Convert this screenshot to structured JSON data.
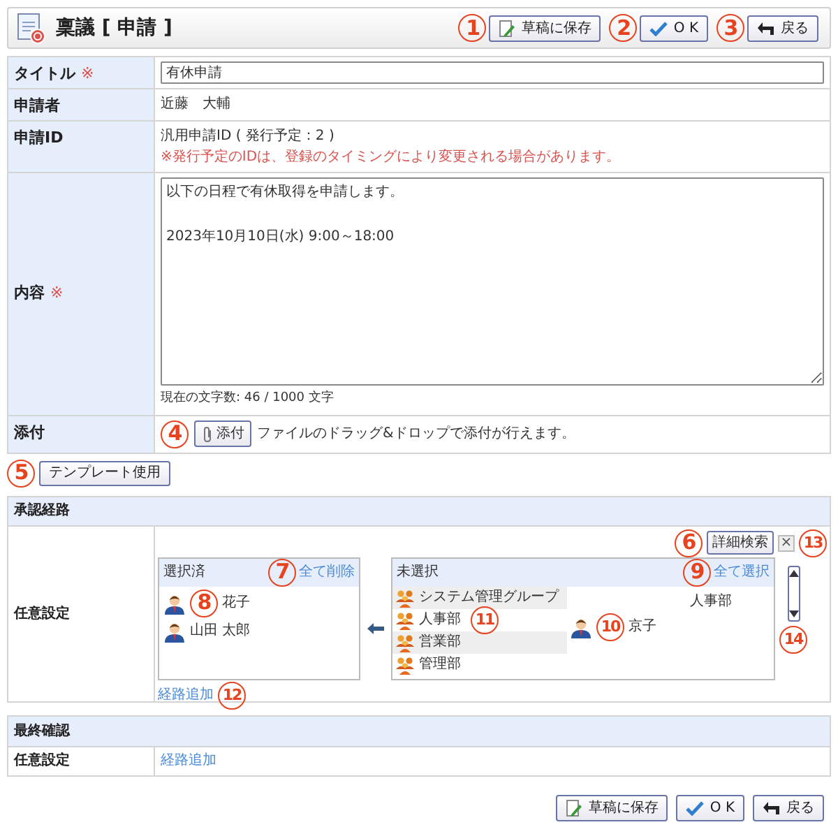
{
  "header": {
    "title": "稟議 [ 申請 ]",
    "buttons": [
      {
        "kind": "save",
        "label": "草稿に保存"
      },
      {
        "kind": "ok",
        "label": "O K"
      },
      {
        "kind": "back",
        "label": "戻る"
      }
    ]
  },
  "form": {
    "rows": [
      {
        "kind": "input",
        "label": "タイトル",
        "mark": "※",
        "value": "有休申請"
      },
      {
        "kind": "text",
        "label": "申請者",
        "text": "近藤　大輔"
      },
      {
        "kind": "id",
        "label": "申請ID",
        "text": "汎用申請ID ( 発行予定：2 )",
        "note": "※発行予定のIDは、登録のタイミングにより変更される場合があります。"
      },
      {
        "kind": "textarea",
        "label": "内容",
        "mark": "※",
        "paragraphs": [
          "以下の日程で有休取得を申請します。",
          "2023年10月10日(水) 9:00～18:00"
        ],
        "counter": "現在の文字数: 46 / 1000 文字"
      },
      {
        "kind": "attach",
        "label": "添付",
        "button": "添付",
        "hint": "ファイルのドラッグ&ドロップで添付が行えます。"
      }
    ]
  },
  "template_button": "テンプレート使用",
  "approval": {
    "title": "承認経路",
    "row_label": "任意設定",
    "search_button": "詳細検索",
    "close": "×",
    "selected": {
      "title": "選択済",
      "action": "全て削除",
      "users": [
        "花子",
        "山田 太郎"
      ]
    },
    "unselected": {
      "title": "未選択",
      "action": "全て選択",
      "groups": [
        "システム管理グループ",
        "人事部",
        "営業部",
        "管理部"
      ],
      "group_heading": "人事部",
      "users": [
        "京子"
      ]
    },
    "add_link": "経路追加"
  },
  "final": {
    "title": "最終確認",
    "row_label": "任意設定",
    "add_link": "経路追加"
  },
  "footer_buttons": [
    {
      "kind": "save",
      "label": "草稿に保存"
    },
    {
      "kind": "ok",
      "label": "O K"
    },
    {
      "kind": "back",
      "label": "戻る"
    }
  ],
  "annotations": [
    "1",
    "2",
    "3",
    "4",
    "5",
    "6",
    "7",
    "8",
    "9",
    "10",
    "11",
    "12",
    "13",
    "14"
  ]
}
